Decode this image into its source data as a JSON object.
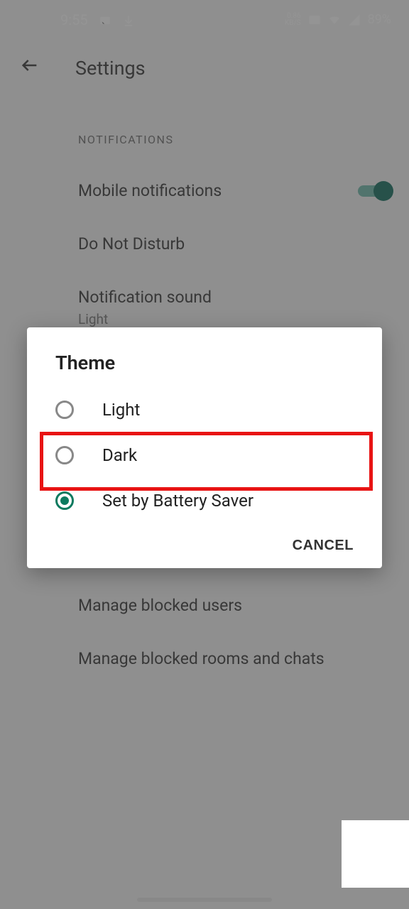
{
  "status": {
    "time": "9:55",
    "net_speed": "0.86",
    "net_unit": "KB/S",
    "battery": "89%"
  },
  "appbar": {
    "title": "Settings"
  },
  "sections": {
    "notifications": {
      "header": "NOTIFICATIONS",
      "mobile": "Mobile notifications",
      "dnd": "Do Not Disturb",
      "sound_title": "Notification sound",
      "sound_value": "Light"
    },
    "blocked": {
      "users": "Manage blocked users",
      "rooms": "Manage blocked rooms and chats"
    }
  },
  "dialog": {
    "title": "Theme",
    "options": {
      "light": "Light",
      "dark": "Dark",
      "battery": "Set by Battery Saver"
    },
    "cancel": "CANCEL"
  }
}
